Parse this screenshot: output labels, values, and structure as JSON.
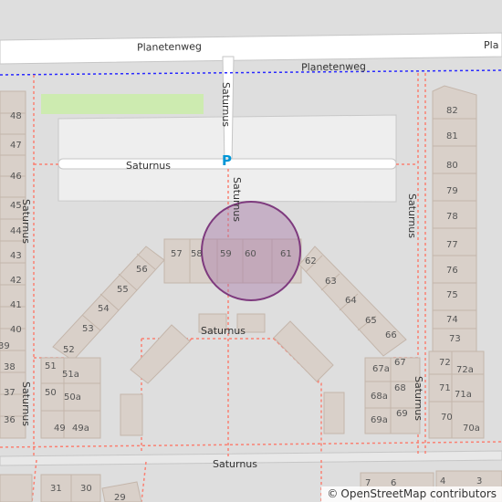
{
  "map": {
    "streets": {
      "planetenweg_main": "Planetenweg",
      "planetenweg_edge": "Pla",
      "planetenweg_path": "Planetenweg",
      "saturnus_vertical_north": "Saturnus",
      "saturnus_vertical_mid": "Saturnus",
      "saturnus_parking_road": "Saturnus",
      "saturnus_west": "Saturnus",
      "saturnus_west_south": "Saturnus",
      "saturnus_east": "Saturnus",
      "saturnus_east_south": "Saturnus",
      "saturnus_center": "Saturnus",
      "saturnus_south": "Saturnus"
    },
    "parking_symbol": "P",
    "house_numbers": {
      "west_column": [
        "48",
        "47",
        "46",
        "45",
        "44",
        "43",
        "42",
        "41",
        "40",
        "39",
        "38",
        "37",
        "36"
      ],
      "east_column": [
        "82",
        "81",
        "80",
        "79",
        "78",
        "77",
        "76",
        "75",
        "74",
        "73"
      ],
      "arc_top": [
        "57",
        "58",
        "59",
        "60",
        "61"
      ],
      "arc_left": [
        "56",
        "55",
        "54",
        "53",
        "52"
      ],
      "arc_right": [
        "62",
        "63",
        "64",
        "65",
        "66"
      ],
      "southwest_block": [
        "51",
        "51a",
        "50",
        "50a",
        "49",
        "49a"
      ],
      "southeast_block": [
        "67a",
        "67",
        "68a",
        "68",
        "69a",
        "69"
      ],
      "east_lower": [
        "72",
        "72a",
        "71",
        "71a",
        "70",
        "70a"
      ],
      "south_row": [
        "31",
        "30",
        "29"
      ],
      "south_east_row": [
        "7",
        "6",
        "4",
        "3"
      ]
    },
    "colors": {
      "background": "#dedede",
      "building": "#d9d0c9",
      "building_outline": "#c4b6ab",
      "road": "#ffffff",
      "footpath": "#fa8072",
      "boundary": "#2a2aff",
      "grass": "#cdebb0",
      "parking": "#eeeeee",
      "marker_fill": "#a87aa8",
      "marker_stroke": "#7e3a7e",
      "parking_symbol": "#0096d6"
    },
    "attribution": {
      "symbol": "©",
      "text": "OpenStreetMap contributors"
    }
  }
}
